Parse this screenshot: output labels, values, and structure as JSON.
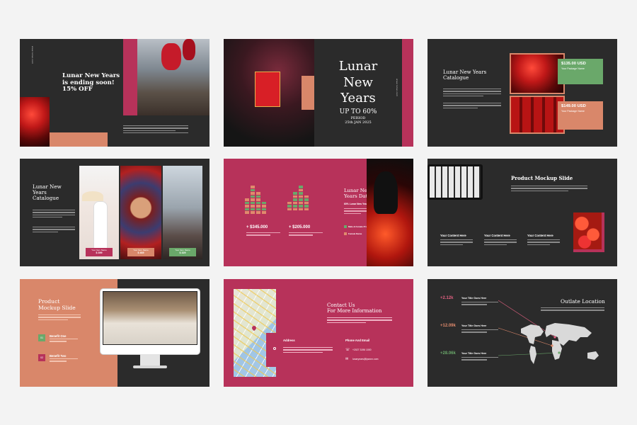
{
  "slide1": {
    "vertical": "www.lunar.com",
    "title_line1": "Lunar New Years",
    "title_line2": "is ending soon!",
    "title_line3": "15% OFF"
  },
  "slide2": {
    "title_line1": "Lunar",
    "title_line2": "New",
    "title_line3": "Years",
    "subtitle": "UP TO 60%",
    "period": "PERIOD",
    "date": "25th JAN 2025",
    "vertical": "www.lunar.com"
  },
  "slide3": {
    "title_line1": "Lunar New Years",
    "title_line2": "Catalogue",
    "price1": "$135.00 USD",
    "package1": "Your Package Name",
    "price2": "$149.00 USD",
    "package2": "Your Package Name"
  },
  "slide4": {
    "title_line1": "Lunar New",
    "title_line2": "Years",
    "title_line3": "Catalogue",
    "items": [
      {
        "name": "Your Item Name",
        "price": "$ 399"
      },
      {
        "name": "Your Item Name",
        "price": "$ 469"
      },
      {
        "name": "Your Item Name",
        "price": "$ 329"
      }
    ]
  },
  "slide5": {
    "title_line1": "Lunar New",
    "title_line2": "Years Database",
    "subtitle": "60% Lunar New Years Data Income",
    "stat1": "+ $345.000",
    "stat2": "+ $205.000",
    "legend1": "Male & Female Product",
    "legend2": "Female Name",
    "chart_data": {
      "type": "bar",
      "series": [
        {
          "values": [
            5,
            9,
            7,
            4
          ]
        },
        {
          "values": [
            3,
            6,
            8,
            5
          ]
        }
      ]
    },
    "colors": {
      "green": "#6aa86a",
      "salmon": "#e08a6c"
    }
  },
  "slide6": {
    "title": "Product Mockup Slide",
    "col1": "Your Content Here",
    "col2": "Your Content Here",
    "col3": "Your Content Here"
  },
  "slide7": {
    "title_line1": "Product",
    "title_line2": "Mockup Slide",
    "benefit1": "Benefit One",
    "benefit2": "Benefit Two",
    "badge1": "01",
    "badge2": "02"
  },
  "slide8": {
    "title_line1": "Contact Us",
    "title_line2": "For More Information",
    "address_label": "Address",
    "phone_label": "Phone And Email",
    "phone": "+2027 3196 1000",
    "email": "lunaryears@lpworx.com"
  },
  "slide9": {
    "title": "Outlate Location",
    "stats": [
      {
        "value": "+2.12k",
        "label": "Your Title Goes Here",
        "color": "#e06080"
      },
      {
        "value": "+12.09k",
        "label": "Your Title Goes Here",
        "color": "#e08a6c"
      },
      {
        "value": "+28.06k",
        "label": "Your Title Goes Here",
        "color": "#6aa86a"
      }
    ]
  }
}
